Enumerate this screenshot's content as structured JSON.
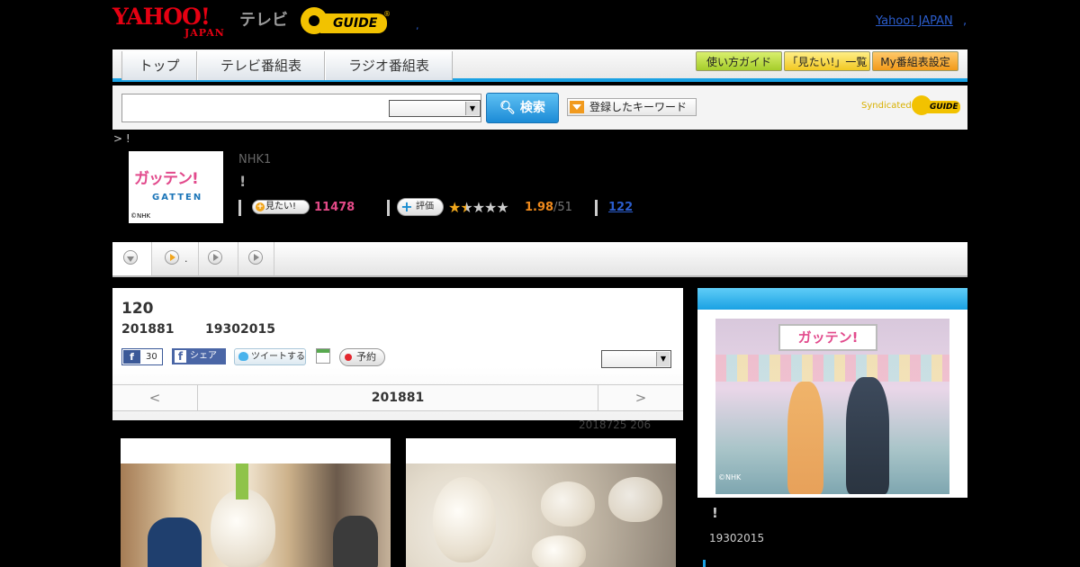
{
  "header": {
    "yahoo_logo_top": "YAHOO!",
    "yahoo_logo_bottom": "JAPAN",
    "tv_label": "テレビ",
    "gguide_logo": "GUIDE",
    "gguide_mark": "®",
    "mid_dot": ",",
    "yahoo_japan_link": "Yahoo! JAPAN",
    "yahoo_japan_link_suffix": ","
  },
  "nav": {
    "tabs": [
      {
        "label": "トップ"
      },
      {
        "label": "テレビ番組表"
      },
      {
        "label": "ラジオ番組表"
      }
    ],
    "buttons": [
      {
        "label": "使い方ガイド"
      },
      {
        "label": "「見たい!」一覧"
      },
      {
        "label": "My番組表設定"
      }
    ],
    "accent_color": "#1aa1e3"
  },
  "search": {
    "input_value": "",
    "select_value": "",
    "search_button": "検索",
    "keyword_button": "登録したキーワード",
    "syndicated_label": "Syndicated",
    "syndicated_logo": "GUIDE"
  },
  "breadcrumb": "> !",
  "program": {
    "thumb_title": "ガッテン!",
    "thumb_sub": "GATTEN",
    "thumb_copy": "©NHK",
    "channel": "NHK1",
    "title": "!",
    "mitai_button": "見たい!",
    "mitai_count": "11478",
    "hyoka_button": "評価",
    "rating": 1.98,
    "rating_display": "1.98",
    "rating_total": "/51",
    "review_count": "122"
  },
  "subtabs": {
    "items": [
      {
        "icon": "chevron-down-icon",
        "label": ""
      },
      {
        "icon": "play-icon",
        "label": "."
      },
      {
        "icon": "play-icon",
        "label": ""
      },
      {
        "icon": "play-icon",
        "label": ""
      }
    ]
  },
  "episode": {
    "number": "120",
    "date": "201881",
    "time": "19302015",
    "fb_count": "30",
    "fb_share": "シェア",
    "tweet": "ツイートする",
    "reserve": "予約",
    "select_value": "",
    "prev_arrow": "<",
    "current_date": "201881",
    "next_arrow": ">",
    "update_info": "2018725  206"
  },
  "sidebar": {
    "banner_text": "ガッテン!",
    "image_copy": "©NHK",
    "title": "!",
    "time": "19302015"
  }
}
